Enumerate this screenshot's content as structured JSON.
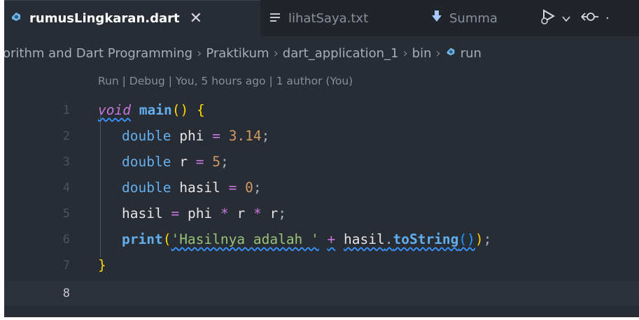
{
  "tabs": [
    {
      "label": "rumusLingkaran.dart",
      "icon": "dart-icon",
      "active": true,
      "close": "✕"
    },
    {
      "label": "lihatSaya.txt",
      "icon": "text-lines-icon",
      "active": false
    },
    {
      "label": "Summa",
      "icon": "download-arrow-icon",
      "active": false
    }
  ],
  "toolbar": {
    "run_debug_icon": "run-debug-icon",
    "dropdown_icon": "chevron-down-icon",
    "source_control_icon": "git-commit-icon"
  },
  "breadcrumb": {
    "items": [
      "orithm and Dart Programming",
      "Praktikum",
      "dart_application_1",
      "bin",
      "run"
    ],
    "separator": "›"
  },
  "codelens": "Run | Debug | You, 5 hours ago | 1 author (You)",
  "code": {
    "line_numbers": [
      "1",
      "2",
      "3",
      "4",
      "5",
      "6",
      "7",
      "8"
    ],
    "l1": {
      "kw": "void",
      "fn": "main",
      "rest": "() {"
    },
    "l2": {
      "type": "double",
      "name": "phi",
      "eq": "=",
      "num": "3.14",
      "end": ";"
    },
    "l3": {
      "type": "double",
      "name": "r",
      "eq": "=",
      "num": "5",
      "end": ";"
    },
    "l4": {
      "type": "double",
      "name": "hasil",
      "eq": "=",
      "num": "0",
      "end": ";"
    },
    "l5": {
      "name": "hasil",
      "eq": "=",
      "a": "phi",
      "mul": "*",
      "b": "r",
      "c": "r",
      "end": ";"
    },
    "l6": {
      "fn": "print",
      "open": "(",
      "str": "'Hasilnya adalah '",
      "plus": "+",
      "obj": "hasil",
      "dot": ".",
      "method": "toString",
      "call": "()",
      "close": ")",
      "end": ";"
    },
    "l7": {
      "brace": "}"
    }
  },
  "colors": {
    "background": "#282c34",
    "tabbar": "#21252b",
    "keyword": "#c678dd",
    "function": "#61afef",
    "string": "#98c379",
    "number": "#d19a66",
    "brace": "#ffd700",
    "squiggle": "#3794ff"
  }
}
